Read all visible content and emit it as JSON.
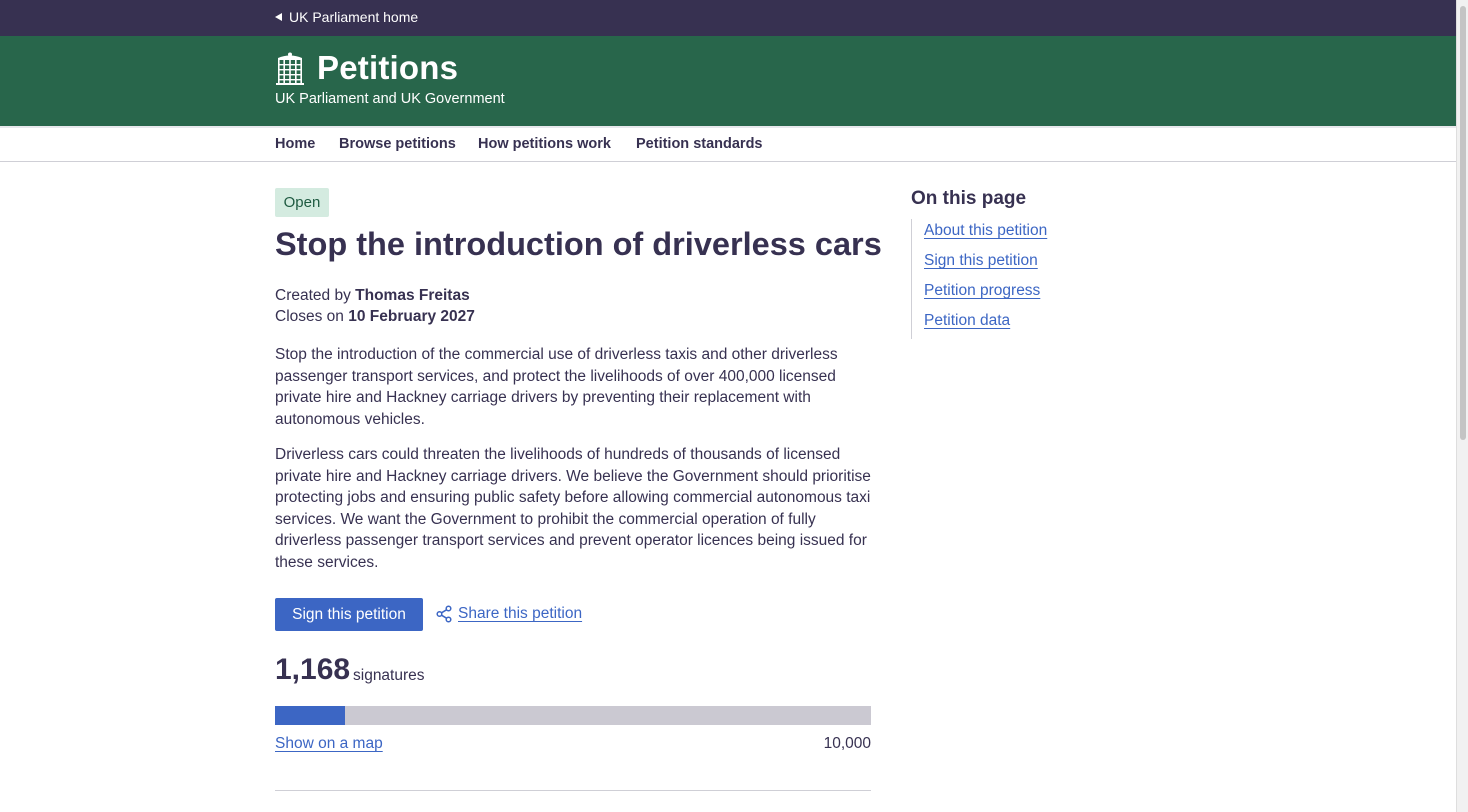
{
  "topbar": {
    "link": "UK Parliament home"
  },
  "brand": {
    "title": "Petitions",
    "subtitle": "UK Parliament and UK Government"
  },
  "nav": {
    "items": [
      "Home",
      "Browse petitions",
      "How petitions work",
      "Petition standards"
    ]
  },
  "petition": {
    "status": "Open",
    "title": "Stop the introduction of driverless cars",
    "created_by_label": "Created by",
    "creator": "Thomas Freitas",
    "closes_label": "Closes on",
    "close_date": "10 February 2027",
    "paragraph_1": "Stop the introduction of the commercial use of driverless taxis and other driverless passenger transport services, and protect the livelihoods of over 400,000 licensed private hire and Hackney carriage drivers by preventing their replacement with autonomous vehicles.",
    "paragraph_2": "Driverless cars could threaten the livelihoods of hundreds of thousands of licensed private hire and Hackney carriage drivers. We believe the Government should prioritise protecting jobs and ensuring public safety before allowing commercial autonomous taxi services. We want the Government to prohibit the commercial operation of fully driverless passenger transport services and prevent operator licences being issued for these services.",
    "sign_label": "Sign this petition",
    "share_label": "Share this petition",
    "signature_count": "1,168",
    "signatures_label": "signatures",
    "signature_value": 1168,
    "goal_value": 10000,
    "map_label": "Show on a map",
    "goal_label": "10,000"
  },
  "toc": {
    "title": "On this page",
    "items": [
      "About this petition",
      "Sign this petition",
      "Petition progress",
      "Petition data"
    ]
  },
  "colors": {
    "topbar": "#373151",
    "brand": "#28664b",
    "accent": "#3c66c4",
    "badge_bg": "#d4ebe0"
  }
}
